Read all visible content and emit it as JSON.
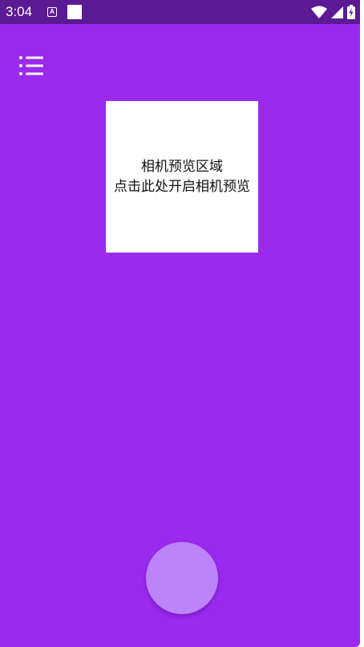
{
  "status_bar": {
    "time": "3:04",
    "notification_icons": [
      "app-notification-icon",
      "blank-notification-icon"
    ],
    "system_icons": [
      "wifi-icon",
      "cell-signal-icon",
      "battery-charging-icon"
    ]
  },
  "toolbar": {
    "menu_icon": "list-menu-icon"
  },
  "camera_preview": {
    "line1": "相机预览区域",
    "line2": "点击此处开启相机预览"
  },
  "fab": {
    "label": ""
  },
  "colors": {
    "background": "#9B2AEF",
    "status_bar": "#5B1A94",
    "preview": "#FFFFFF",
    "fab": "#BD84FA"
  }
}
